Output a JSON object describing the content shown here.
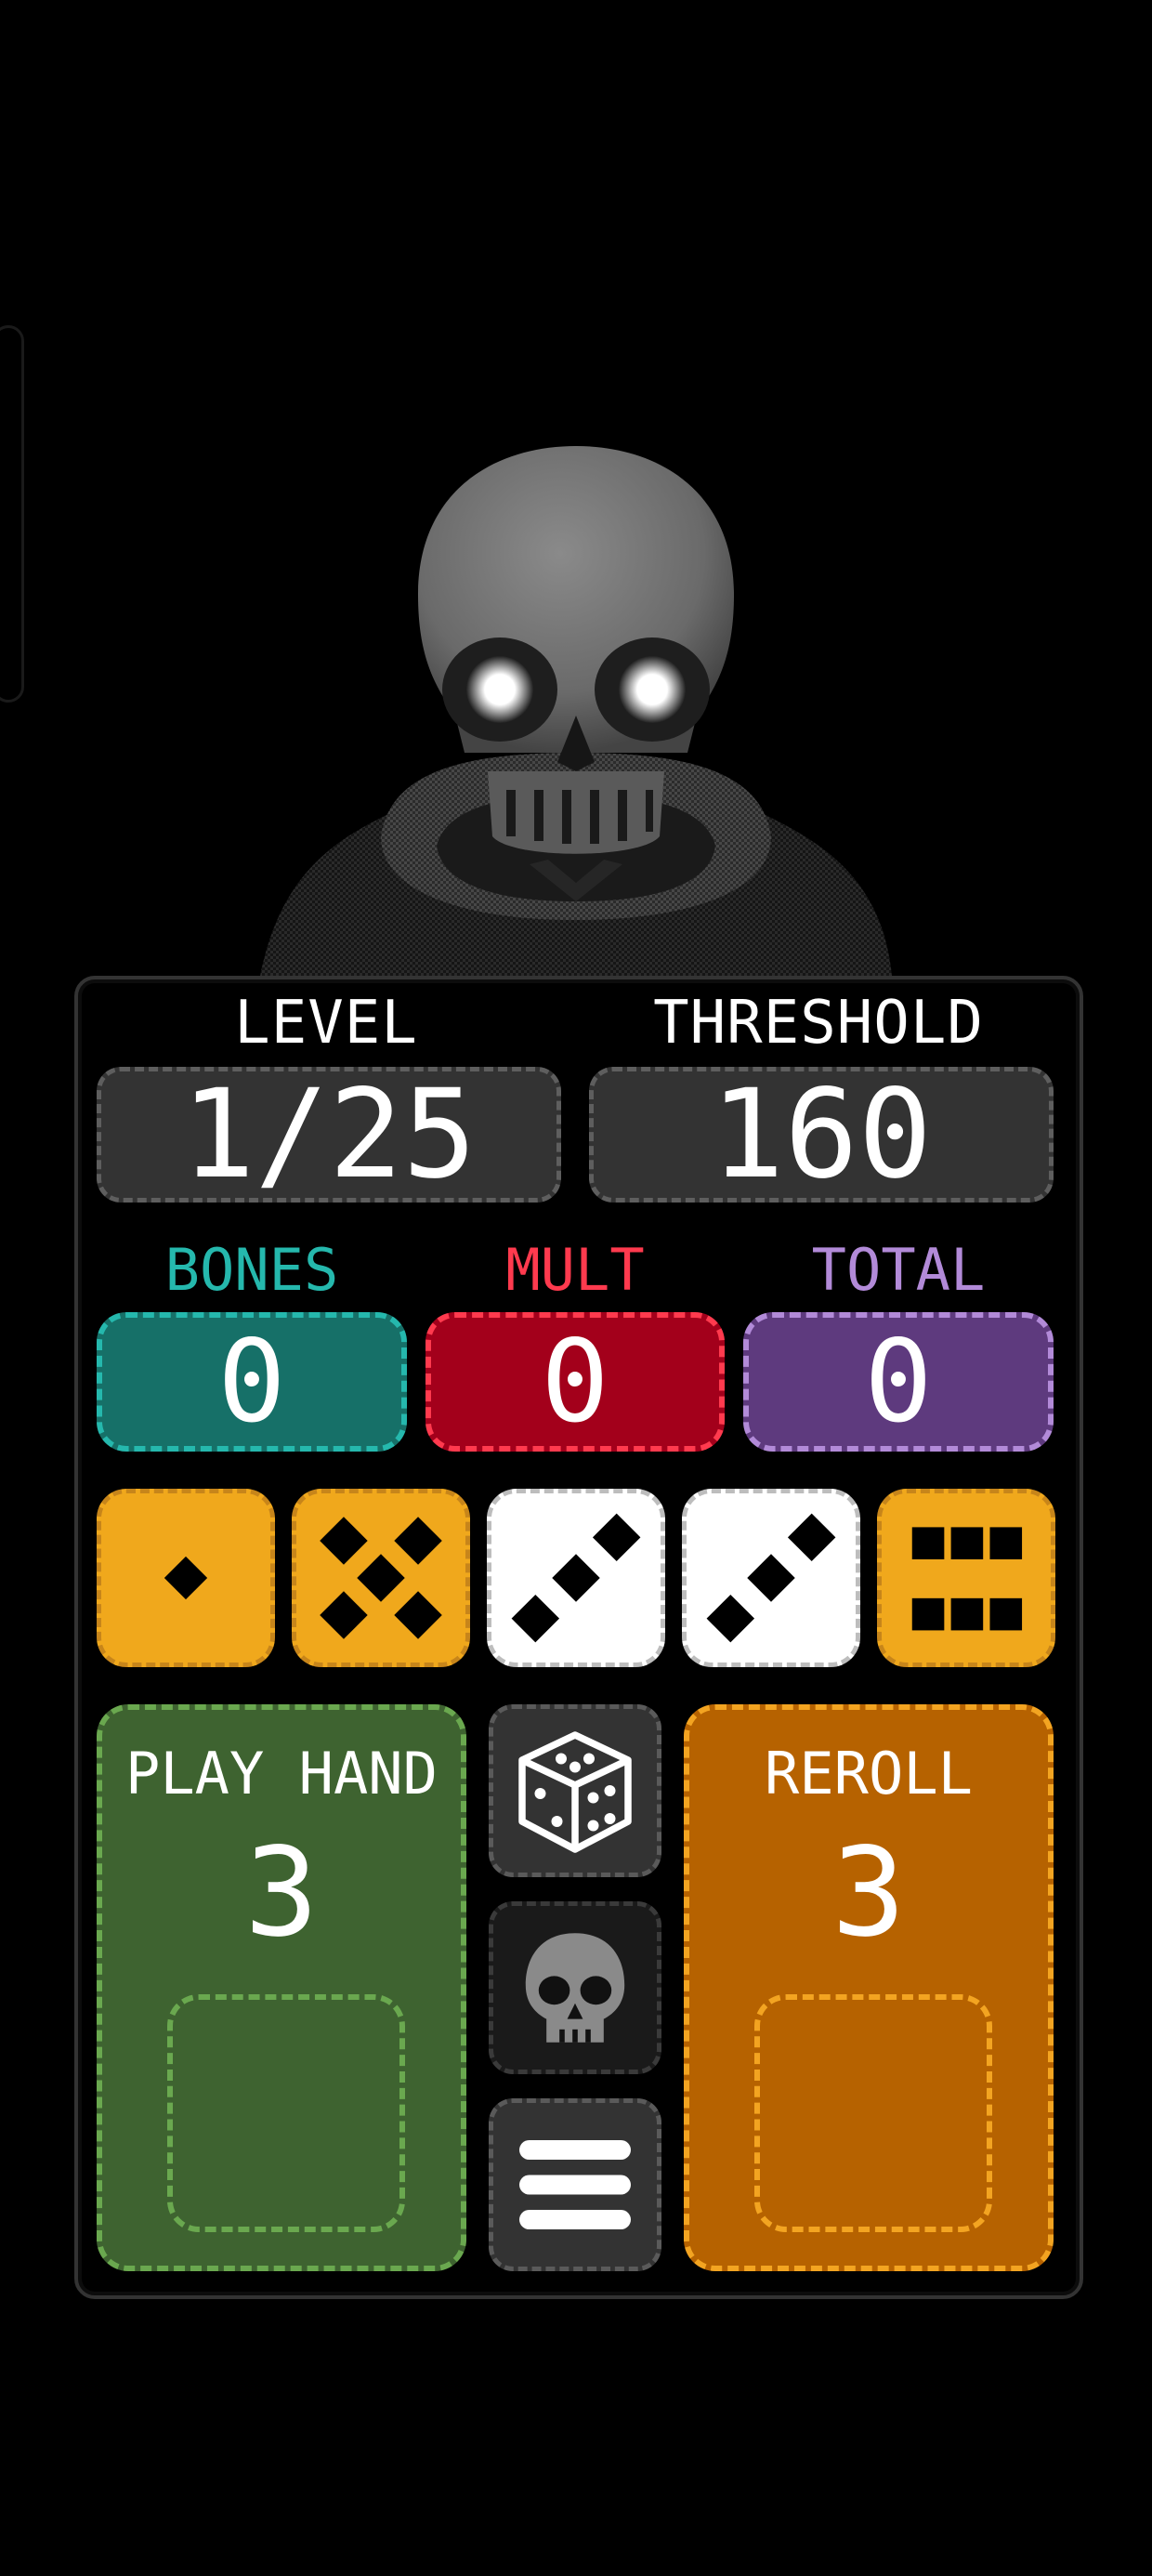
{
  "stats": {
    "level_label": "LEVEL",
    "level_value": "1/25",
    "threshold_label": "THRESHOLD",
    "threshold_value": "160"
  },
  "scores": {
    "bones_label": "BONES",
    "bones_value": "0",
    "mult_label": "MULT",
    "mult_value": "0",
    "total_label": "TOTAL",
    "total_value": "0"
  },
  "dice": [
    {
      "face": 1,
      "color": "yellow"
    },
    {
      "face": 5,
      "color": "yellow"
    },
    {
      "face": 3,
      "color": "white"
    },
    {
      "face": 3,
      "color": "white"
    },
    {
      "face": 6,
      "color": "yellow"
    }
  ],
  "actions": {
    "play_label": "PLAY HAND",
    "play_count": "3",
    "reroll_label": "REROLL",
    "reroll_count": "3"
  },
  "tools": [
    "dice-icon",
    "skull-icon",
    "menu-icon"
  ],
  "colors": {
    "bones": "#167068",
    "bones_accent": "#25b8ad",
    "mult": "#a3001b",
    "mult_accent": "#ff3a4e",
    "total": "#5e3a7e",
    "total_accent": "#b28ad8",
    "die_yellow": "#f0a81c",
    "play": "#3e6330",
    "play_accent": "#6aa84f",
    "reroll": "#b66200",
    "reroll_accent": "#f3a421"
  }
}
